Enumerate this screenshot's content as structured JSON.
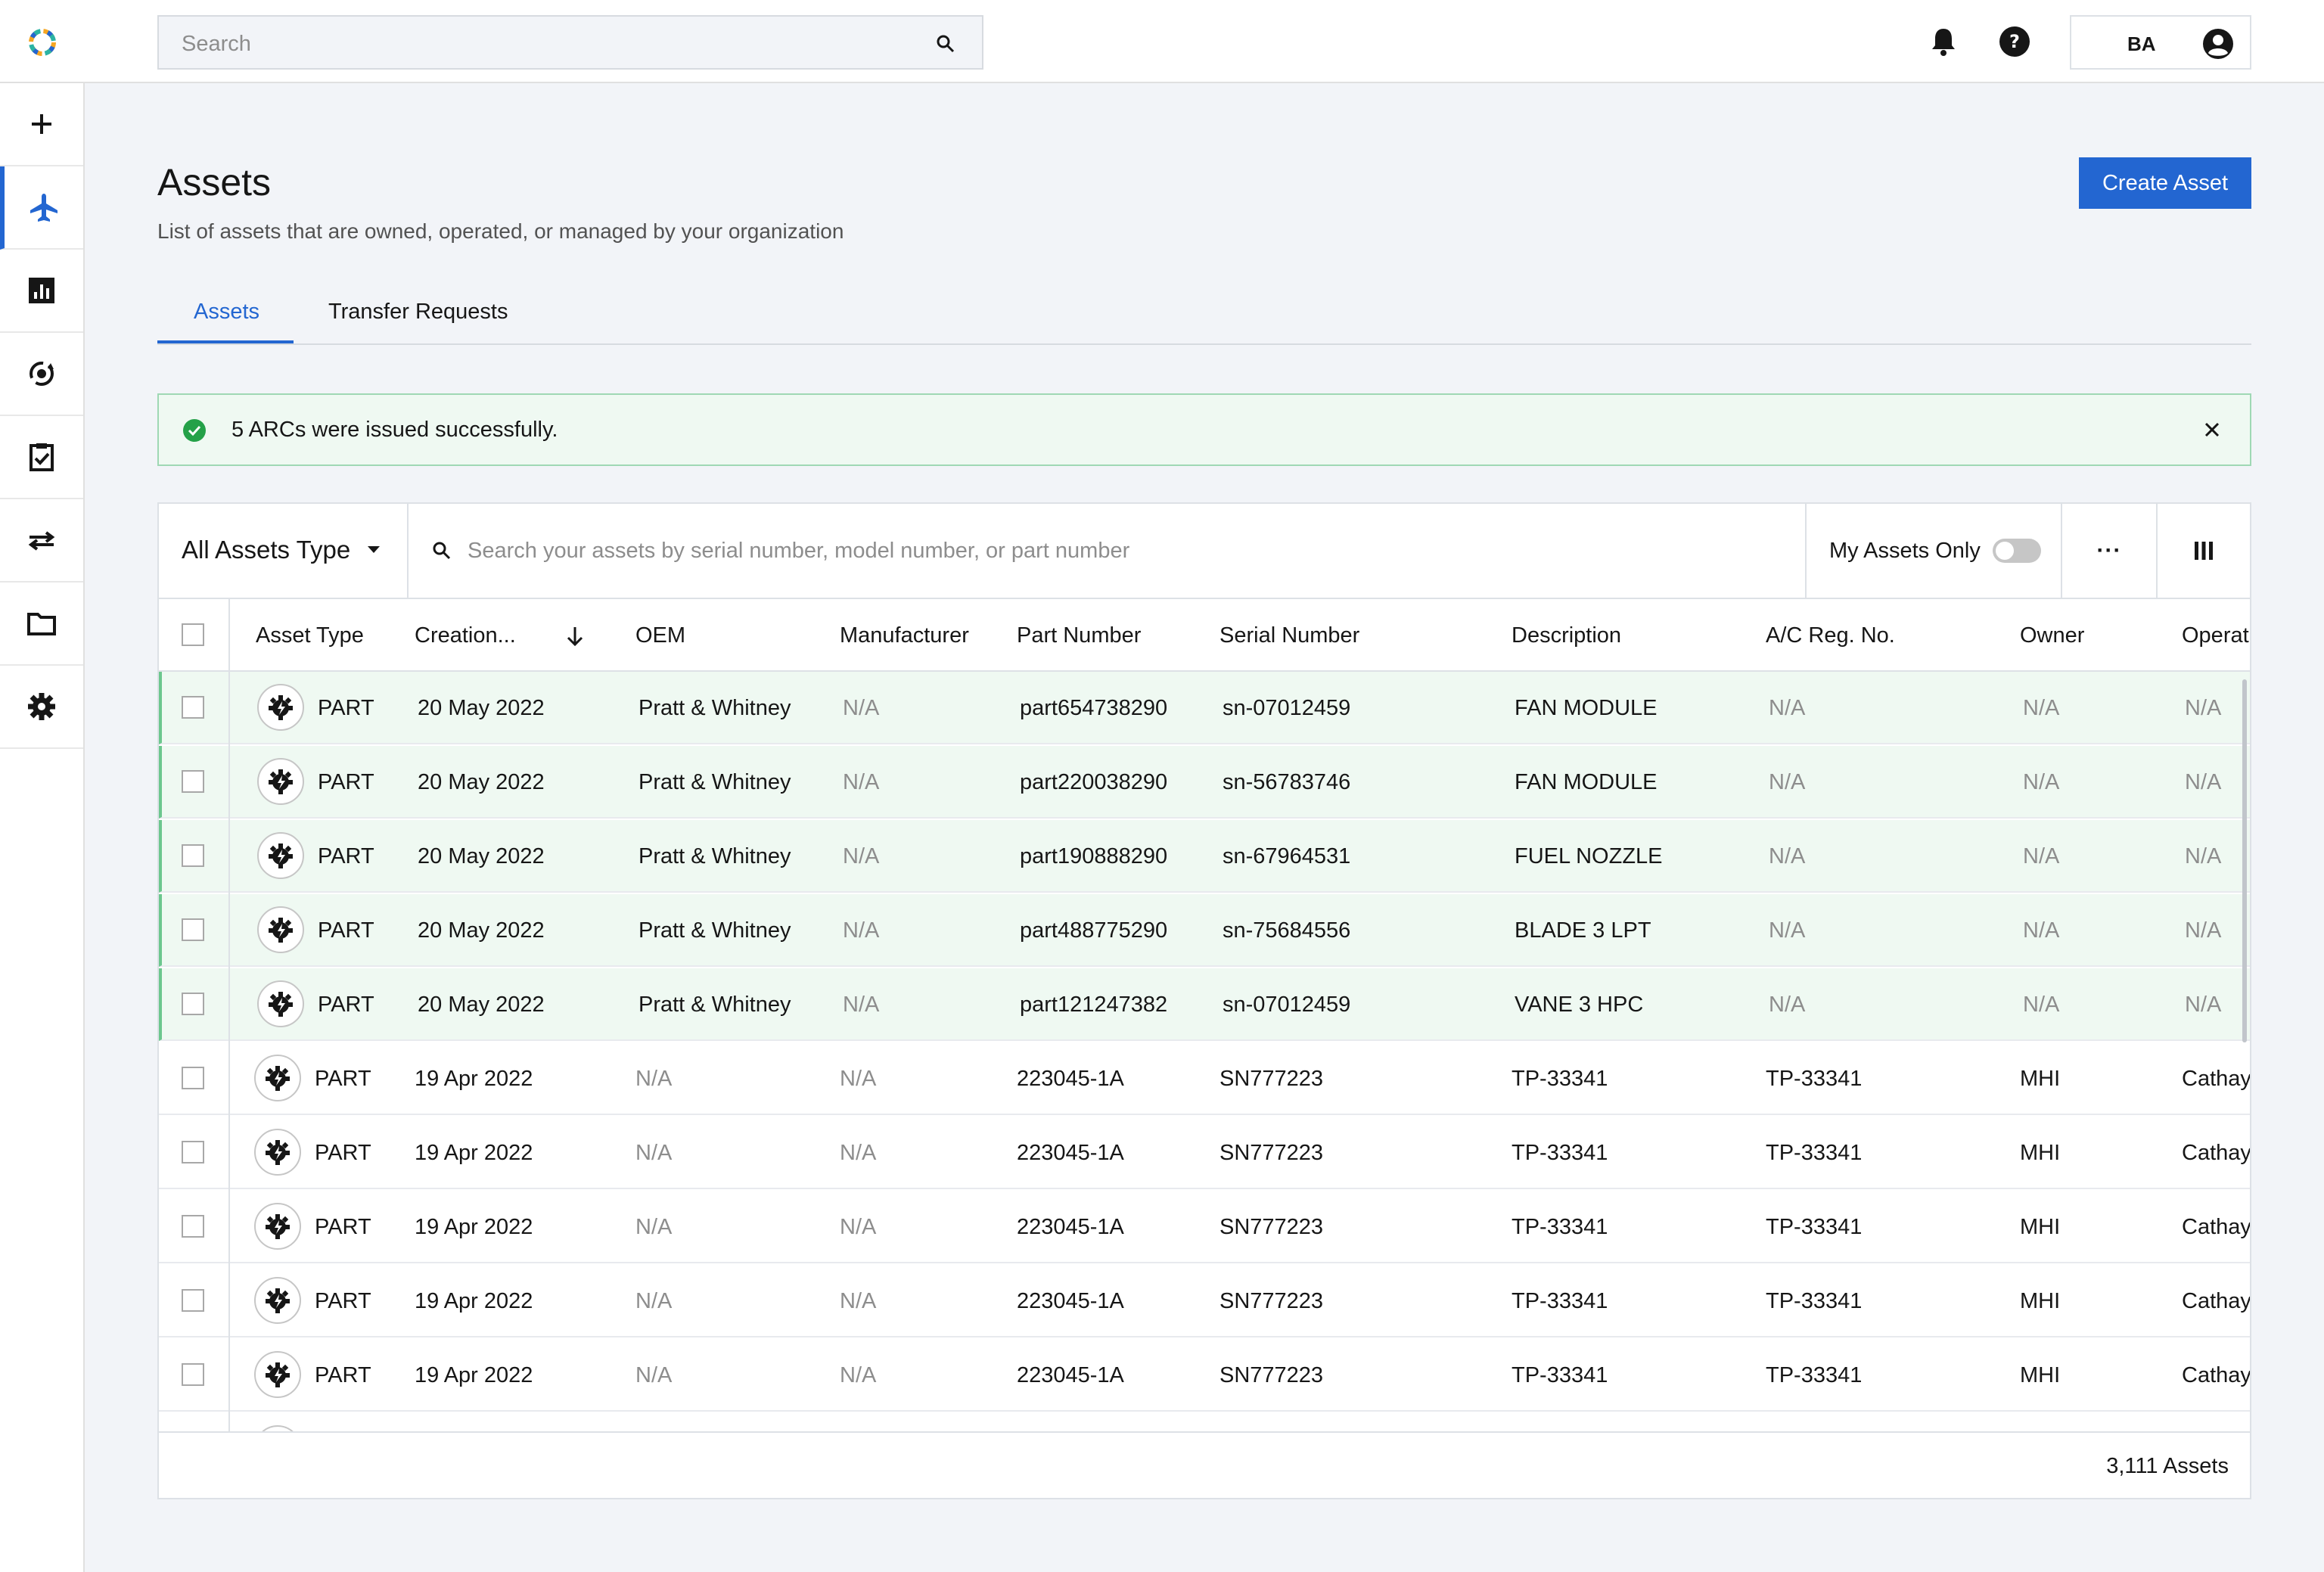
{
  "topbar": {
    "search_placeholder": "Search",
    "user_initials": "BA"
  },
  "sidebar": {
    "items": [
      {
        "name": "add",
        "icon": "plus-icon"
      },
      {
        "name": "assets",
        "icon": "airplane-icon",
        "active": true
      },
      {
        "name": "reports",
        "icon": "chart-icon"
      },
      {
        "name": "maintenance",
        "icon": "cycle-icon"
      },
      {
        "name": "tasks",
        "icon": "clipboard-check-icon"
      },
      {
        "name": "transfers",
        "icon": "transfer-arrows-icon"
      },
      {
        "name": "documents",
        "icon": "folder-icon"
      },
      {
        "name": "settings",
        "icon": "gear-icon"
      }
    ]
  },
  "page": {
    "title": "Assets",
    "subtitle": "List of assets that are owned, operated, or managed by your organization",
    "create_label": "Create Asset"
  },
  "tabs": [
    {
      "label": "Assets",
      "active": true
    },
    {
      "label": "Transfer Requests",
      "active": false
    }
  ],
  "notice": {
    "message": "5 ARCs were issued successfully."
  },
  "toolbar": {
    "type_filter": "All Assets Type",
    "search_placeholder": "Search your assets by serial number, model number, or part number",
    "my_assets_label": "My Assets Only",
    "overflow_label": "···"
  },
  "table": {
    "columns": [
      "Asset Type",
      "Creation...",
      "OEM",
      "Manufacturer",
      "Part Number",
      "Serial Number",
      "Description",
      "A/C Reg. No.",
      "Owner",
      "Operat"
    ],
    "rows": [
      {
        "hl": true,
        "cells": [
          "PART",
          "20 May 2022",
          "Pratt & Whitney",
          "N/A",
          "part654738290",
          "sn-07012459",
          "FAN MODULE",
          "N/A",
          "N/A",
          "N/A"
        ]
      },
      {
        "hl": true,
        "cells": [
          "PART",
          "20 May 2022",
          "Pratt & Whitney",
          "N/A",
          "part220038290",
          "sn-56783746",
          "FAN MODULE",
          "N/A",
          "N/A",
          "N/A"
        ]
      },
      {
        "hl": true,
        "cells": [
          "PART",
          "20 May 2022",
          "Pratt & Whitney",
          "N/A",
          "part190888290",
          "sn-67964531",
          "FUEL NOZZLE",
          "N/A",
          "N/A",
          "N/A"
        ]
      },
      {
        "hl": true,
        "cells": [
          "PART",
          "20 May 2022",
          "Pratt & Whitney",
          "N/A",
          "part488775290",
          "sn-75684556",
          "BLADE 3 LPT",
          "N/A",
          "N/A",
          "N/A"
        ]
      },
      {
        "hl": true,
        "cells": [
          "PART",
          "20 May 2022",
          "Pratt & Whitney",
          "N/A",
          "part121247382",
          "sn-07012459",
          "VANE 3 HPC",
          "N/A",
          "N/A",
          "N/A"
        ]
      },
      {
        "hl": false,
        "cells": [
          "PART",
          "19 Apr 2022",
          "N/A",
          "N/A",
          "223045-1A",
          "SN777223",
          "TP-33341",
          "TP-33341",
          "MHI",
          "Cathay"
        ]
      },
      {
        "hl": false,
        "cells": [
          "PART",
          "19 Apr 2022",
          "N/A",
          "N/A",
          "223045-1A",
          "SN777223",
          "TP-33341",
          "TP-33341",
          "MHI",
          "Cathay"
        ]
      },
      {
        "hl": false,
        "cells": [
          "PART",
          "19 Apr 2022",
          "N/A",
          "N/A",
          "223045-1A",
          "SN777223",
          "TP-33341",
          "TP-33341",
          "MHI",
          "Cathay"
        ]
      },
      {
        "hl": false,
        "cells": [
          "PART",
          "19 Apr 2022",
          "N/A",
          "N/A",
          "223045-1A",
          "SN777223",
          "TP-33341",
          "TP-33341",
          "MHI",
          "Cathay"
        ]
      },
      {
        "hl": false,
        "cells": [
          "PART",
          "19 Apr 2022",
          "N/A",
          "N/A",
          "223045-1A",
          "SN777223",
          "TP-33341",
          "TP-33341",
          "MHI",
          "Cathay"
        ]
      },
      {
        "hl": false,
        "cells": [
          "",
          "",
          "",
          "",
          "",
          "",
          "",
          "",
          "",
          ""
        ]
      }
    ],
    "footer_count": "3,111 Assets"
  },
  "colors": {
    "accent": "#2366d1",
    "success_bg": "#eff9f2",
    "success_border": "#9fd8b4",
    "success_icon": "#24a148"
  }
}
